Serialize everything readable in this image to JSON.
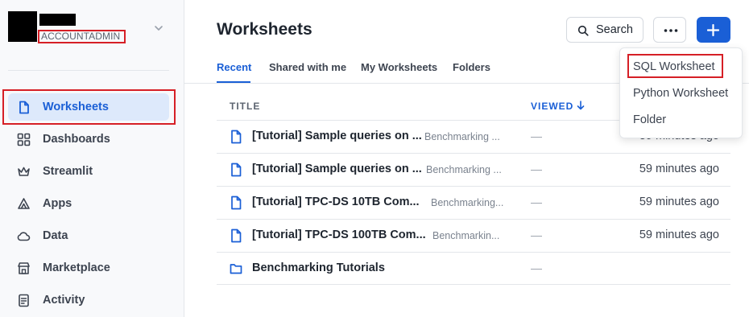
{
  "sidebar": {
    "account_role": "ACCOUNTADMIN",
    "items": [
      {
        "label": "Worksheets",
        "icon": "file-icon",
        "active": true
      },
      {
        "label": "Dashboards",
        "icon": "grid-icon"
      },
      {
        "label": "Streamlit",
        "icon": "crown-icon"
      },
      {
        "label": "Apps",
        "icon": "apps-icon"
      },
      {
        "label": "Data",
        "icon": "cloud-icon"
      },
      {
        "label": "Marketplace",
        "icon": "store-icon"
      },
      {
        "label": "Activity",
        "icon": "activity-icon"
      }
    ]
  },
  "header": {
    "title": "Worksheets",
    "search_label": "Search"
  },
  "tabs": [
    {
      "label": "Recent",
      "active": true
    },
    {
      "label": "Shared with me"
    },
    {
      "label": "My Worksheets"
    },
    {
      "label": "Folders"
    }
  ],
  "table": {
    "columns": {
      "title": "TITLE",
      "viewed": "VIEWED"
    },
    "rows": [
      {
        "title": "[Tutorial] Sample queries on ...",
        "folder": "Benchmarking ...",
        "viewed": "—",
        "time": "59 minutes ago",
        "type": "worksheet"
      },
      {
        "title": "[Tutorial] Sample queries on ...",
        "folder": "Benchmarking ...",
        "viewed": "—",
        "time": "59 minutes ago",
        "type": "worksheet"
      },
      {
        "title": "[Tutorial] TPC-DS 10TB Com...",
        "folder": "Benchmarking...",
        "viewed": "—",
        "time": "59 minutes ago",
        "type": "worksheet"
      },
      {
        "title": "[Tutorial] TPC-DS 100TB Com...",
        "folder": "Benchmarkin...",
        "viewed": "—",
        "time": "59 minutes ago",
        "type": "worksheet"
      },
      {
        "title": "Benchmarking Tutorials",
        "folder": "",
        "viewed": "—",
        "time": "",
        "type": "folder"
      }
    ]
  },
  "new_menu": {
    "items": [
      "SQL Worksheet",
      "Python Worksheet",
      "Folder"
    ]
  },
  "colors": {
    "accent": "#1a5fd6",
    "highlight_outline": "#d61f26"
  }
}
